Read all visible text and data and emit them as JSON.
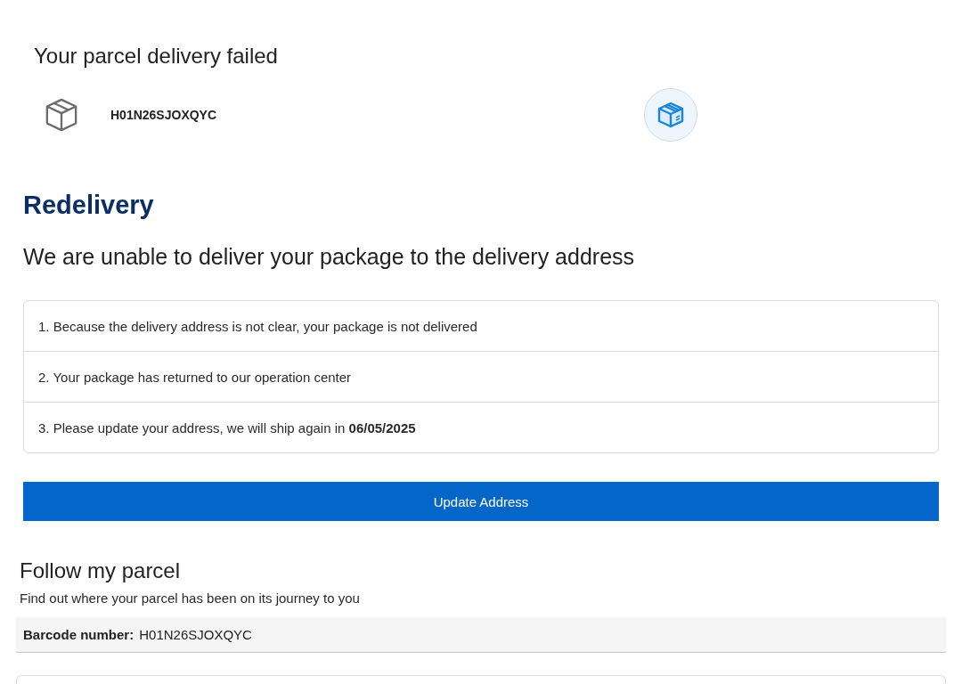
{
  "header": {
    "title": "Your parcel delivery failed",
    "tracking_code": "H01N26SJOXQYC"
  },
  "redelivery": {
    "title": "Redelivery",
    "subtitle": "We are unable to deliver your package to the delivery address",
    "steps": [
      "1. Because the delivery address is not clear, your package is not delivered",
      "2. Your package has returned to our operation center",
      "3. Please update your address, we will ship again in **06/05/2025**"
    ],
    "button": "Update Address"
  },
  "follow": {
    "title": "Follow my parcel",
    "description": "Find out where your parcel has been on its journey to you",
    "barcode_label": "Barcode number:",
    "barcode_value": "H01N26SJOXQYC"
  }
}
